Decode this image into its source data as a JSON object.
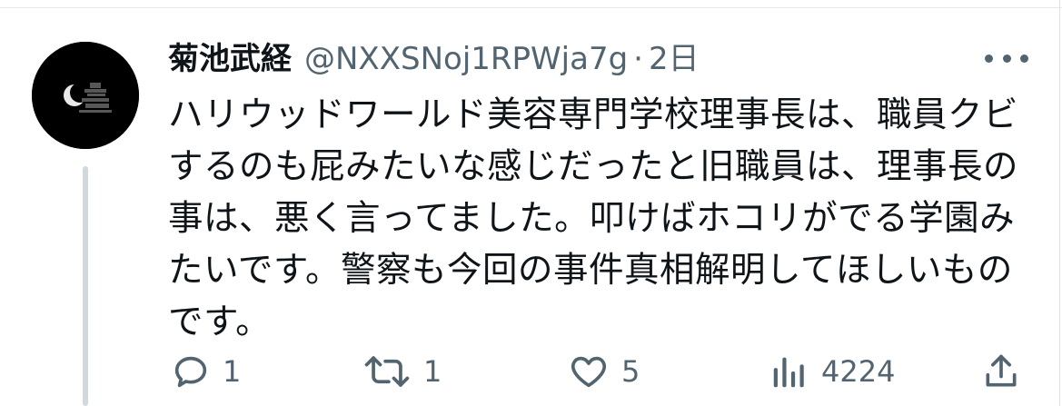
{
  "tweet": {
    "display_name": "菊池武経",
    "handle": "@NXXSNoj1RPWja7g",
    "separator": "·",
    "time": "2日",
    "text": "ハリウッドワールド美容専門学校理事長は、職員クビ\nするのも屁みたいな感じだったと旧職員は、理事長の\n事は、悪く言ってました。叩けばホコリがでる学園み\nたいです。警察も今回の事件真相解明してほしいもの\nです。"
  },
  "actions": {
    "reply_count": "1",
    "retweet_count": "1",
    "like_count": "5",
    "views_count": "4224"
  },
  "icons": {
    "more": "more-horizontal-icon",
    "reply": "reply-icon",
    "retweet": "retweet-icon",
    "like": "heart-icon",
    "views": "analytics-icon",
    "share": "share-icon"
  },
  "colors": {
    "text": "#0f1419",
    "secondary": "#536471",
    "thread_line": "#cfd9de"
  }
}
